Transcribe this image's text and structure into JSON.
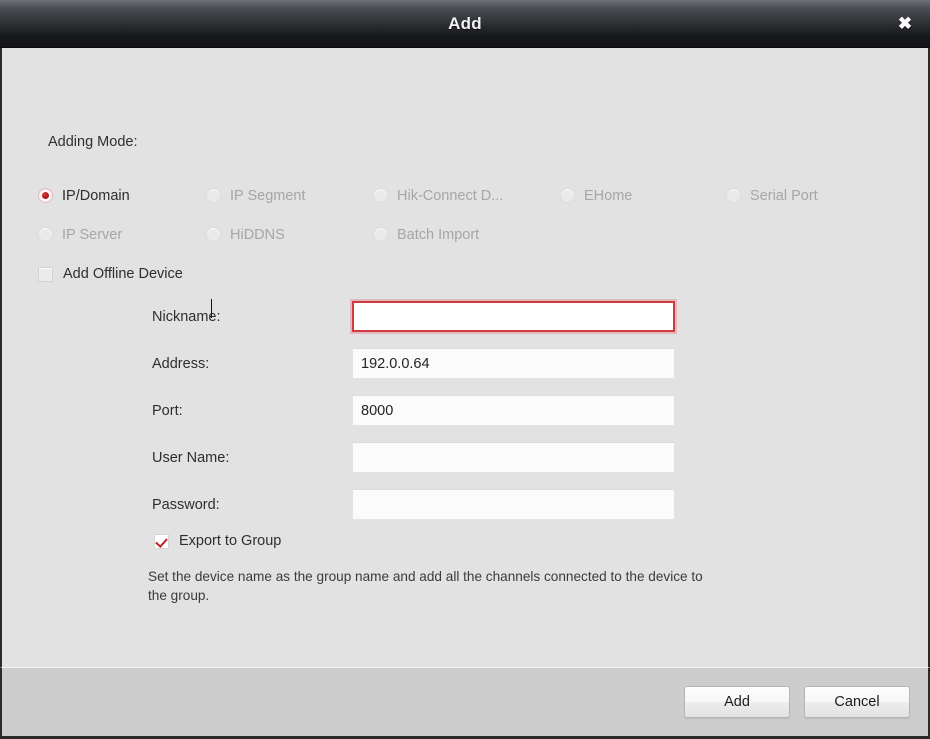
{
  "window": {
    "title": "Add",
    "close_icon": "close-icon",
    "close_glyph": "✖"
  },
  "form_section": {
    "adding_mode_label": "Adding Mode:",
    "modes": [
      {
        "label": "IP/Domain",
        "selected": true,
        "disabled": false
      },
      {
        "label": "IP Segment",
        "selected": false,
        "disabled": true
      },
      {
        "label": "Hik-Connect D...",
        "selected": false,
        "disabled": true
      },
      {
        "label": "EHome",
        "selected": false,
        "disabled": true
      },
      {
        "label": "Serial Port",
        "selected": false,
        "disabled": true
      },
      {
        "label": "IP Server",
        "selected": false,
        "disabled": true
      },
      {
        "label": "HiDDNS",
        "selected": false,
        "disabled": true
      },
      {
        "label": "Batch Import",
        "selected": false,
        "disabled": true
      }
    ],
    "add_offline_device": {
      "label": "Add Offline Device",
      "checked": false
    },
    "fields": [
      {
        "label": "Nickname:",
        "value": "",
        "placeholder": "",
        "focused": true,
        "type": "text"
      },
      {
        "label": "Address:",
        "value": "192.0.0.64",
        "placeholder": "",
        "focused": false,
        "type": "text"
      },
      {
        "label": "Port:",
        "value": "8000",
        "placeholder": "",
        "focused": false,
        "type": "text"
      },
      {
        "label": "User Name:",
        "value": "",
        "placeholder": "",
        "focused": false,
        "type": "text"
      },
      {
        "label": "Password:",
        "value": "",
        "placeholder": "",
        "focused": false,
        "type": "password"
      }
    ],
    "export_to_group": {
      "label": "Export to Group",
      "checked": true
    },
    "help_text": "Set the device name as the group name and add all the channels connected to the device to the group."
  },
  "footer": {
    "add_label": "Add",
    "cancel_label": "Cancel"
  },
  "colors": {
    "accent_red": "#b01717",
    "focus_border": "#cf3b3f",
    "titlebar_dark": "#17181a",
    "body_bg": "#e2e2e2",
    "footer_bg": "#cdcdcd"
  }
}
